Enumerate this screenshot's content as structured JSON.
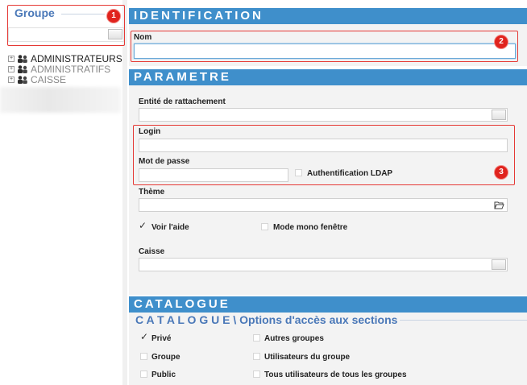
{
  "left_panel": {
    "title": "Groupe",
    "tree": [
      {
        "label": "ADMINISTRATEURS",
        "muted": false
      },
      {
        "label": "ADMINISTRATIFS",
        "muted": true
      },
      {
        "label": "CAISSE",
        "muted": true
      }
    ]
  },
  "identification": {
    "header": "IDENTIFICATION",
    "nom_label": "Nom",
    "nom_value": ""
  },
  "parametre": {
    "header": "PARAMETRE",
    "entite_label": "Entité de rattachement",
    "login_label": "Login",
    "password_label": "Mot de passe",
    "ldap_label": "Authentification LDAP",
    "theme_label": "Thème",
    "voir_aide_label": "Voir l'aide",
    "voir_aide_checked": true,
    "mono_fenetre_label": "Mode mono fenêtre",
    "mono_fenetre_checked": false,
    "caisse_label": "Caisse"
  },
  "catalogue": {
    "header": "CATALOGUE",
    "sub_title_prefix": "C A T A L O G U E \\",
    "sub_title_suffix": " Options d'accès aux sections",
    "options": [
      {
        "label": "Privé",
        "checked": true
      },
      {
        "label": "Autres groupes",
        "checked": false
      },
      {
        "label": "Groupe",
        "checked": false
      },
      {
        "label": "Utilisateurs du groupe",
        "checked": false
      },
      {
        "label": "Public",
        "checked": false
      },
      {
        "label": "Tous utilisateurs de tous les groupes",
        "checked": false
      }
    ]
  },
  "annotations": [
    "1",
    "2",
    "3"
  ],
  "colors": {
    "header_blue": "#3f8fcb",
    "title_blue": "#4a78b8",
    "annotation_red": "#e0231d"
  }
}
